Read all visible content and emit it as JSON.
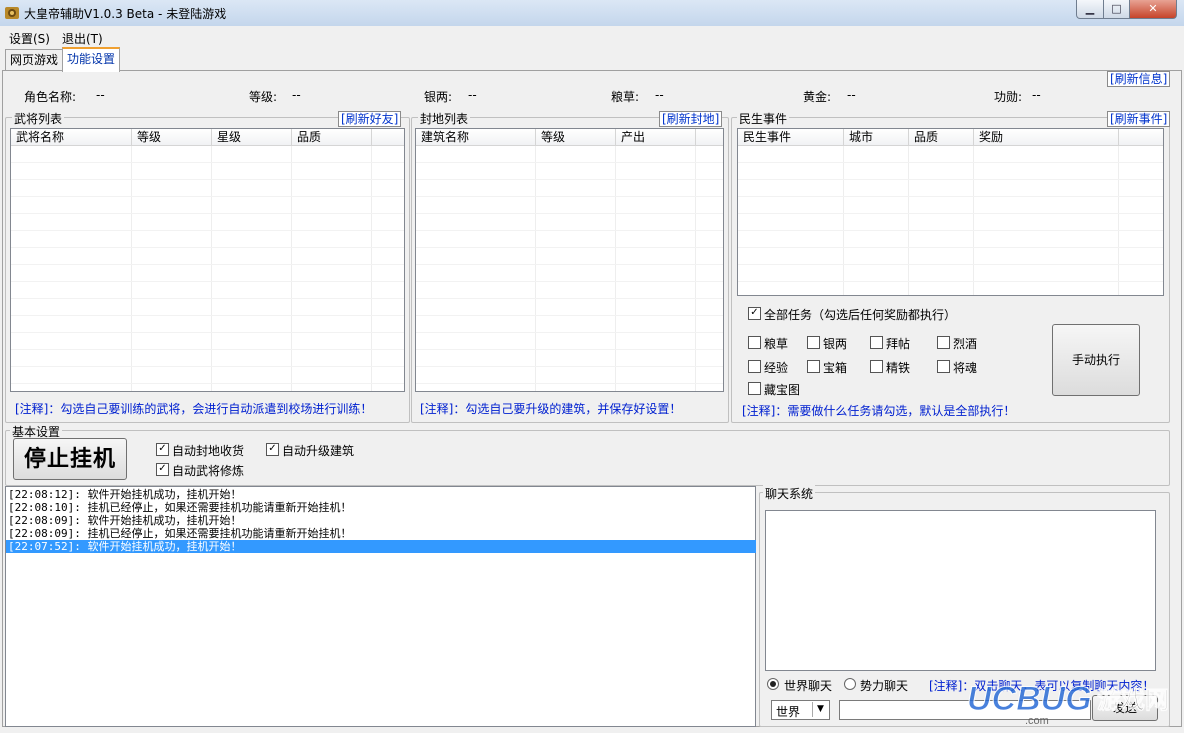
{
  "window": {
    "title": "大皇帝辅助V1.0.3 Beta - 未登陆游戏"
  },
  "menu": [
    "设置(S)",
    "退出(T)"
  ],
  "tabs": [
    {
      "label": "网页游戏"
    },
    {
      "label": "功能设置"
    }
  ],
  "info": {
    "role_name_label": "角色名称:",
    "role_name_value": "--",
    "level_label": "等级:",
    "level_value": "--",
    "silver_label": "银两:",
    "silver_value": "--",
    "grain_label": "粮草:",
    "grain_value": "--",
    "gold_label": "黄金:",
    "gold_value": "--",
    "merit_label": "功勋:",
    "merit_value": "--",
    "refresh_label": "[刷新信息]"
  },
  "generals": {
    "title": "武将列表",
    "refresh": "[刷新好友]",
    "columns": [
      "武将名称",
      "等级",
      "星级",
      "品质"
    ],
    "note": "[注释]：勾选自己要训练的武将，会进行自动派遣到校场进行训练！"
  },
  "fiefs": {
    "title": "封地列表",
    "refresh": "[刷新封地]",
    "columns": [
      "建筑名称",
      "等级",
      "产出"
    ],
    "note": "[注释]：勾选自己要升级的建筑，并保存好设置！"
  },
  "events": {
    "title": "民生事件",
    "refresh": "[刷新事件]",
    "columns": [
      "民生事件",
      "城市",
      "品质",
      "奖励"
    ],
    "all_tasks": "全部任务（勾选后任何奖励都执行）",
    "options": [
      "粮草",
      "银两",
      "拜帖",
      "烈酒",
      "经验",
      "宝箱",
      "精铁",
      "将魂",
      "藏宝图"
    ],
    "manual_button": "手动执行",
    "note": "[注释]：需要做什么任务请勾选，默认是全部执行！"
  },
  "basic": {
    "title": "基本设置",
    "stop_button": "停止挂机",
    "auto_fief": "自动封地收货",
    "auto_build": "自动升级建筑",
    "auto_train": "自动武将修炼"
  },
  "log": [
    "[22:08:12]: 软件开始挂机成功，挂机开始！",
    "[22:08:10]: 挂机已经停止，如果还需要挂机功能请重新开始挂机！",
    "[22:08:09]: 软件开始挂机成功，挂机开始！",
    "[22:08:09]: 挂机已经停止，如果还需要挂机功能请重新开始挂机！",
    "[22:07:52]: 软件开始挂机成功，挂机开始！"
  ],
  "chat": {
    "title": "聊天系统",
    "world_radio": "世界聊天",
    "faction_radio": "势力聊天",
    "note": "[注释]：双击聊天，表可以复制聊天内容！",
    "channel": "世界",
    "send": "发送"
  },
  "watermark": "UCBUG游戏网"
}
